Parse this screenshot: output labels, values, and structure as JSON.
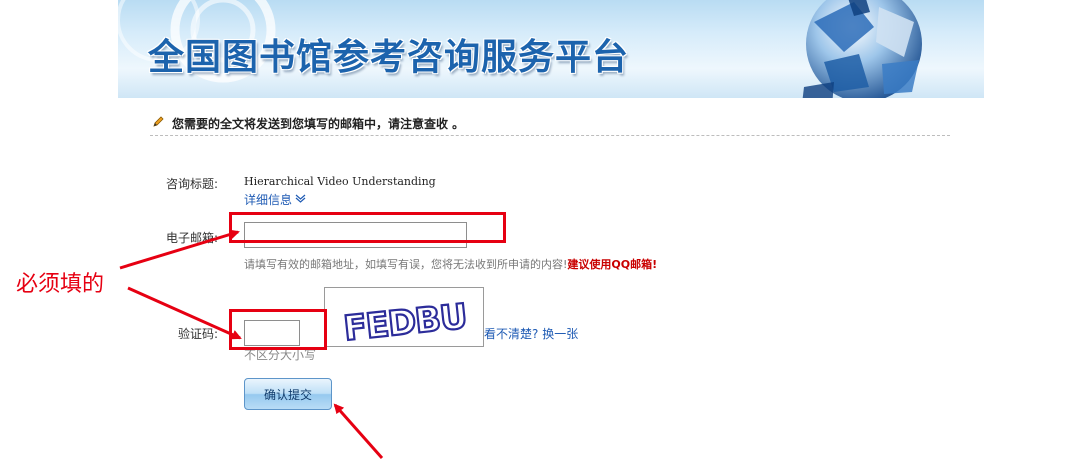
{
  "banner": {
    "title": "全国图书馆参考咨询服务平台"
  },
  "notice": {
    "text": "您需要的全文将发送到您填写的邮箱中，请注意查收 。"
  },
  "form": {
    "title_label": "咨询标题:",
    "title_value": "Hierarchical Video Understanding",
    "detail_link": "详细信息",
    "email_label": "电子邮箱:",
    "email_value": "",
    "email_hint": "请填写有效的邮箱地址，如填写有误，您将无法收到所申请的内容!",
    "email_hint_recommend": "建议使用QQ邮箱!",
    "captcha_label": "验证码:",
    "captcha_value": "",
    "captcha_text": "FEDBU",
    "captcha_refresh_prefix": "看不清楚?",
    "captcha_refresh_link": "换一张",
    "captcha_case_hint": "不区分大小写",
    "submit_label": "确认提交"
  },
  "annotation": {
    "text": "必须填的",
    "color": "#e60012"
  },
  "colors": {
    "link": "#1f5bb4",
    "banner_title": "#1c63ad",
    "warning": "#c90000"
  }
}
